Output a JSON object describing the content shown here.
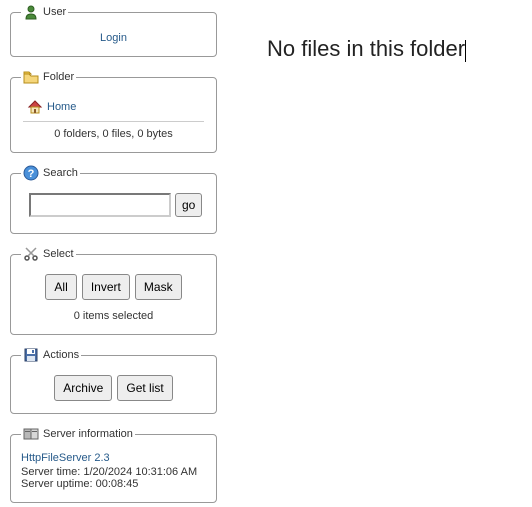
{
  "user": {
    "legend": "User",
    "login_label": "Login"
  },
  "folder": {
    "legend": "Folder",
    "home_label": "Home",
    "stats": "0 folders, 0 files, 0 bytes"
  },
  "search": {
    "legend": "Search",
    "value": "",
    "go_label": "go"
  },
  "select": {
    "legend": "Select",
    "all_label": "All",
    "invert_label": "Invert",
    "mask_label": "Mask",
    "count_text": "0 items selected"
  },
  "actions": {
    "legend": "Actions",
    "archive_label": "Archive",
    "getlist_label": "Get list"
  },
  "server": {
    "legend": "Server information",
    "product": "HttpFileServer 2.3",
    "time_label": "Server time: 1/20/2024 10:31:06 AM",
    "uptime_label": "Server uptime: 00:08:45"
  },
  "main": {
    "empty_text": "No files in this folder"
  }
}
